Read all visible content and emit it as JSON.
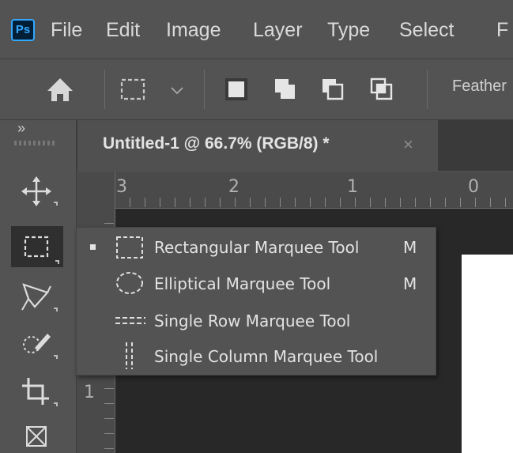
{
  "app": {
    "logo_text": "Ps"
  },
  "menubar": {
    "items": [
      {
        "label": "File"
      },
      {
        "label": "Edit"
      },
      {
        "label": "Image"
      },
      {
        "label": "Layer"
      },
      {
        "label": "Type"
      },
      {
        "label": "Select"
      },
      {
        "label": "F"
      }
    ]
  },
  "options_bar": {
    "icons": [
      "home-icon",
      "marquee-preset-icon",
      "dropdown-chevron-icon",
      "new-selection-icon",
      "add-to-selection-icon",
      "subtract-from-selection-icon",
      "intersect-selection-icon"
    ],
    "feather_label": "Feather"
  },
  "document": {
    "tab_title": "Untitled-1 @ 66.7% (RGB/8) *",
    "close_glyph": "×",
    "canvas_color": "#ffffff"
  },
  "rulers": {
    "horizontal": [
      "3",
      "2",
      "1",
      "0"
    ],
    "vertical": [
      "1"
    ]
  },
  "toolbar": {
    "collapse_glyph": "»",
    "tools": [
      "move-tool",
      "marquee-tool",
      "lasso-tool",
      "quick-selection-tool",
      "crop-tool",
      "frame-tool"
    ],
    "active_tool": "marquee-tool"
  },
  "flyout": {
    "items": [
      {
        "label": "Rectangular Marquee Tool",
        "shortcut": "M",
        "selected": true,
        "icon": "rectangular-marquee-icon"
      },
      {
        "label": "Elliptical Marquee Tool",
        "shortcut": "M",
        "selected": false,
        "icon": "elliptical-marquee-icon"
      },
      {
        "label": "Single Row Marquee Tool",
        "shortcut": "",
        "selected": false,
        "icon": "single-row-marquee-icon"
      },
      {
        "label": "Single Column Marquee Tool",
        "shortcut": "",
        "selected": false,
        "icon": "single-column-marquee-icon"
      }
    ]
  },
  "colors": {
    "accent": "#31a8ff",
    "panel": "#535353",
    "workspace": "#282828"
  }
}
